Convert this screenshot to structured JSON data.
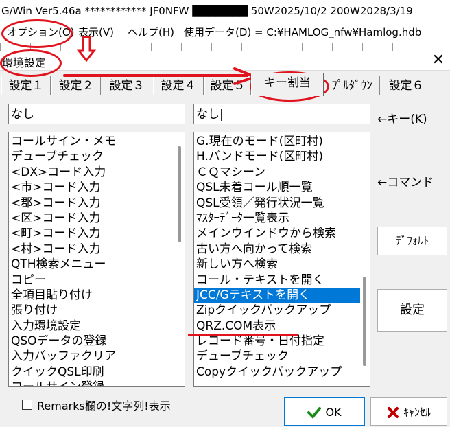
{
  "window": {
    "title_text": "G/Win Ver5.46a ************  JF0NFW ███████  50W2025/10/2 200W2028/3/19"
  },
  "menu": {
    "items": [
      "オプション(O)",
      "表示(V)",
      "ヘルプ(H)"
    ],
    "database": "使用データ(D) = C:¥HAMLOG_nfw¥Hamlog.hdb"
  },
  "dialog": {
    "title": "環境設定",
    "close_glyph": "✕"
  },
  "tabs": [
    "設定１",
    "設定２",
    "設定３",
    "設定４",
    "設定５",
    "キー割当",
    "ﾌﾟﾙﾀﾞｳﾝ",
    "設定６"
  ],
  "active_tab": "キー割当",
  "key_field": {
    "value": "なし"
  },
  "command_field": {
    "value": "なし|"
  },
  "labels": {
    "key": "←キー(K)",
    "command": "←コマンド"
  },
  "left_list": [
    "コールサイン・メモ",
    "デューブチェック",
    "<DX>コード入力",
    "<市>コード入力",
    "<郡>コード入力",
    "<区>コード入力",
    "<町>コード入力",
    "<村>コード入力",
    "QTH検索メニュー",
    "コピー",
    "全項目貼り付け",
    "張り付け",
    "入力環境設定",
    "QSOデータの登録",
    "入力バッファクリア",
    "クイックQSL印刷",
    "コールサイン登録"
  ],
  "right_list": [
    "G.現在のモード(区町村)",
    "H.バンドモード(区町村)",
    "ＣＱマシーン",
    "QSL未着コール順一覧",
    "QSL受領／発行状況一覧",
    "ﾏｽﾀｰﾃﾞｰﾀ一覧表示",
    "メインウインドウから検索",
    "古い方へ向かって検索",
    "新しい方へ検索",
    "コール・テキストを開く",
    "JCC/Gテキストを開く",
    "Zipクイックバックアップ",
    "QRZ.COM表示",
    "レコード番号・日付指定",
    "デューブチェック",
    "Copyクイックバックアップ"
  ],
  "right_selected": "JCC/Gテキストを開く",
  "buttons": {
    "default": "ﾃﾞﾌｫﾙﾄ",
    "settings": "設定",
    "ok": "OK",
    "cancel": "ｷｬﾝｾﾙ"
  },
  "checkbox": {
    "label": "Remarks欄の!文字列!表示",
    "checked": false
  },
  "colors": {
    "annotation": "#e0141e",
    "selection": "#0078d7",
    "ok_icon": "#1a8a1a",
    "cancel_icon": "#c00000"
  }
}
